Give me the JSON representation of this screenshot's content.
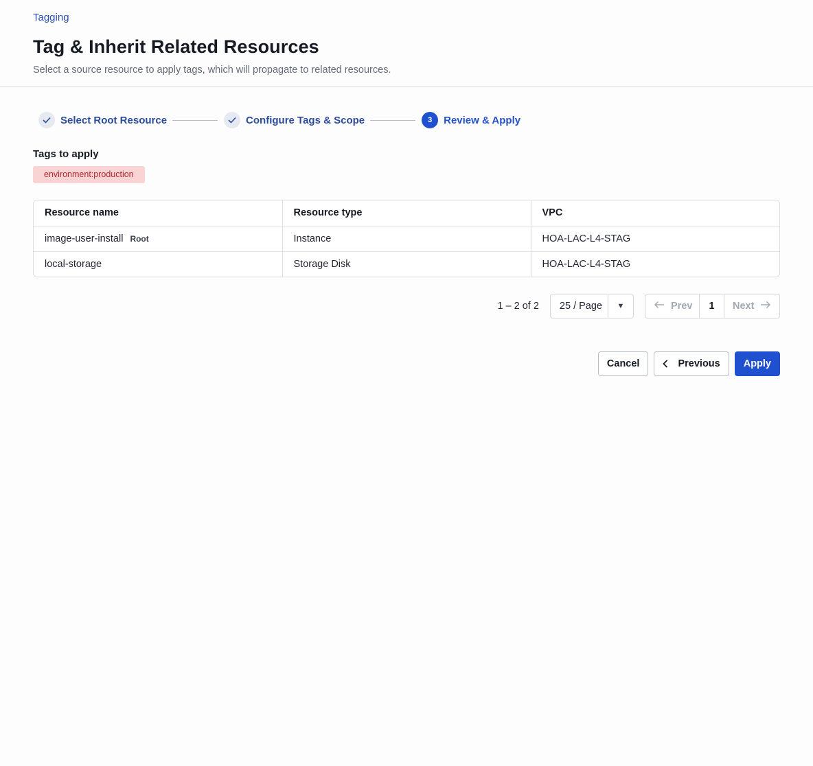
{
  "header": {
    "breadcrumb": "Tagging",
    "title": "Tag & Inherit Related Resources",
    "subtitle": "Select a source resource to apply tags, which will propagate to related resources."
  },
  "stepper": {
    "steps": [
      {
        "label": "Select Root Resource",
        "state": "complete"
      },
      {
        "label": "Configure Tags & Scope",
        "state": "complete"
      },
      {
        "label": "Review & Apply",
        "state": "active",
        "number": "3"
      }
    ]
  },
  "tags_section": {
    "title": "Tags to apply",
    "tags": [
      "environment:production"
    ]
  },
  "table": {
    "columns": [
      "Resource name",
      "Resource type",
      "VPC"
    ],
    "rows": [
      {
        "name": "image-user-install",
        "badge": "Root",
        "type": "Instance",
        "vpc": "HOA-LAC-L4-STAG"
      },
      {
        "name": "local-storage",
        "badge": "",
        "type": "Storage Disk",
        "vpc": "HOA-LAC-L4-STAG"
      }
    ]
  },
  "pagination": {
    "range": "1 – 2 of 2",
    "page_size": "25 / Page",
    "prev_label": "Prev",
    "current_page": "1",
    "next_label": "Next"
  },
  "actions": {
    "cancel": "Cancel",
    "previous": "Previous",
    "apply": "Apply"
  },
  "colors": {
    "primary": "#1e50cf",
    "tag_bg": "#fad4d4",
    "tag_text": "#b3262f"
  }
}
